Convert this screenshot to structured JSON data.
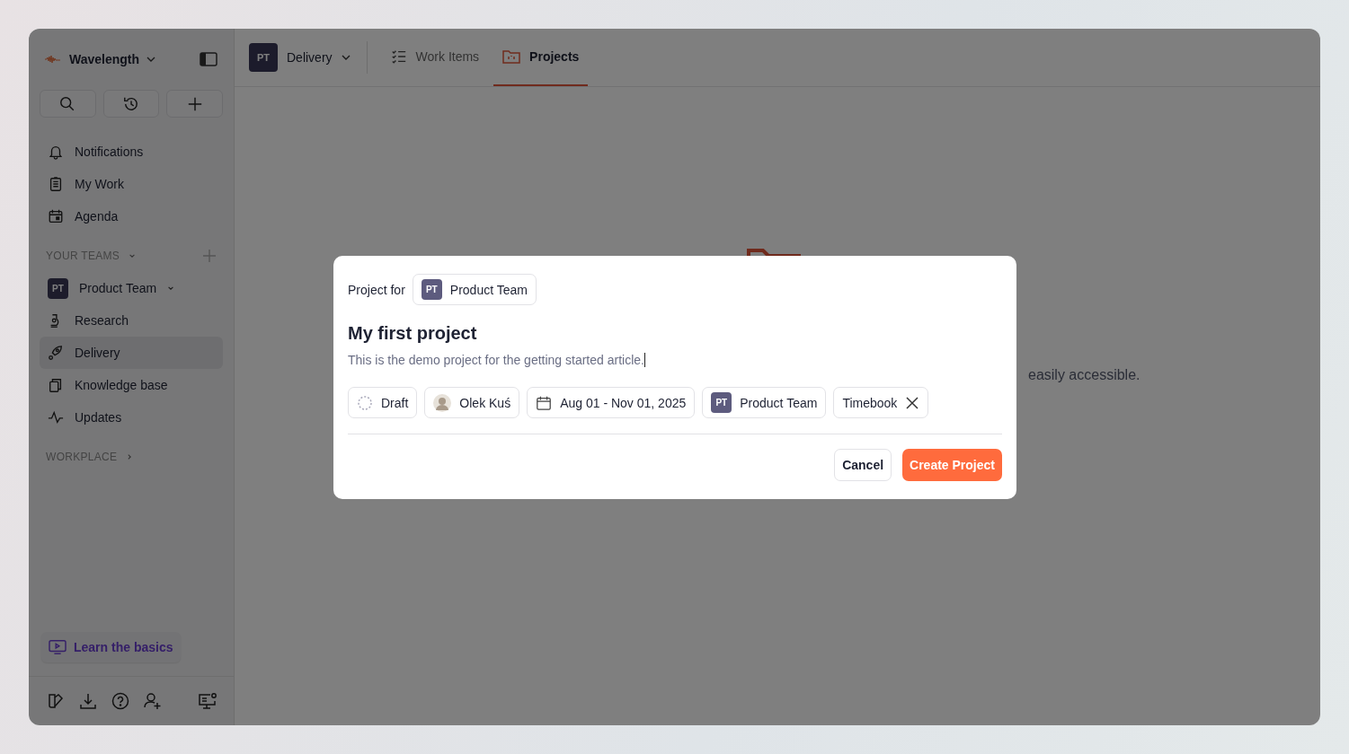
{
  "workspace": {
    "name": "Wavelength"
  },
  "sidebar": {
    "nav": [
      {
        "label": "Notifications"
      },
      {
        "label": "My Work"
      },
      {
        "label": "Agenda"
      }
    ],
    "teams_section": {
      "label": "YOUR TEAMS",
      "expanded": true
    },
    "team": {
      "badge": "PT",
      "name": "Product Team",
      "expanded": true,
      "children": [
        {
          "label": "Research",
          "selected": false
        },
        {
          "label": "Delivery",
          "selected": true
        },
        {
          "label": "Knowledge base",
          "selected": false
        },
        {
          "label": "Updates",
          "selected": false
        }
      ]
    },
    "workplace_section": {
      "label": "WORKPLACE",
      "expanded": false
    },
    "learn_button": "Learn the basics"
  },
  "topbar": {
    "team_badge": "PT",
    "team_name": "Delivery",
    "tabs": [
      {
        "label": "Work Items",
        "selected": false
      },
      {
        "label": "Projects",
        "selected": true
      }
    ]
  },
  "empty_state": {
    "text": "easily accessible."
  },
  "modal": {
    "project_for_label": "Project for",
    "team": {
      "badge": "PT",
      "name": "Product Team"
    },
    "title": "My first project",
    "description": "This is the demo project for the getting started article.",
    "chips": [
      {
        "kind": "status",
        "label": "Draft"
      },
      {
        "kind": "person",
        "label": "Olek Kuś"
      },
      {
        "kind": "date",
        "label": "Aug 01 - Nov 01, 2025"
      },
      {
        "kind": "team",
        "label": "Product Team",
        "badge": "PT"
      },
      {
        "kind": "removable",
        "label": "Timebook"
      }
    ],
    "buttons": [
      {
        "kind": "secondary",
        "label": "Cancel"
      },
      {
        "kind": "primary",
        "label": "Create Project"
      }
    ]
  }
}
